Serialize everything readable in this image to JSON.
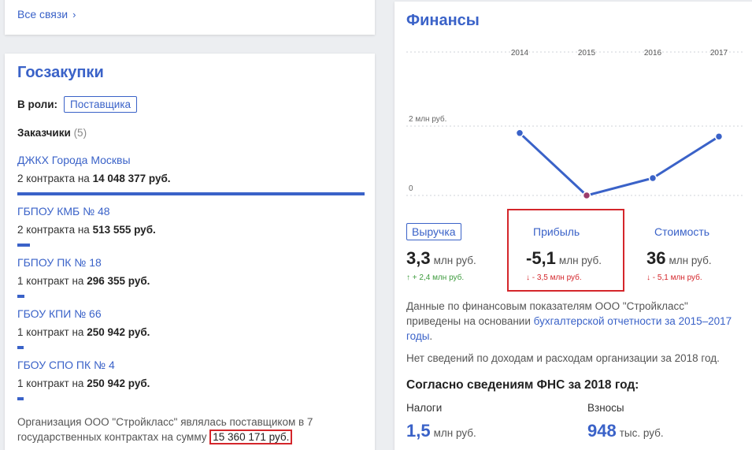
{
  "links_card": {
    "all_links": "Все связи",
    "chevron": "›"
  },
  "goszakupki": {
    "title": "Госзакупки",
    "role_label": "В роли:",
    "role_value": "Поставщика",
    "customers_label": "Заказчики",
    "customers_count": "(5)",
    "customers": [
      {
        "name": "ДЖКХ Города Москвы",
        "info_prefix": "2 контракта на",
        "amount": "14 048 377 руб.",
        "bar_fraction": 1.0
      },
      {
        "name": "ГБПОУ КМБ № 48",
        "info_prefix": "2 контракта на",
        "amount": "513 555 руб.",
        "bar_fraction": 0.037
      },
      {
        "name": "ГБПОУ ПК № 18",
        "info_prefix": "1 контракт на",
        "amount": "296 355 руб.",
        "bar_fraction": 0.021
      },
      {
        "name": "ГБОУ КПИ № 66",
        "info_prefix": "1 контракт на",
        "amount": "250 942 руб.",
        "bar_fraction": 0.018
      },
      {
        "name": "ГБОУ СПО ПК № 4",
        "info_prefix": "1 контракт на",
        "amount": "250 942 руб.",
        "bar_fraction": 0.018
      }
    ],
    "summary_text": "Организация ООО \"Стройкласс\" являлась поставщиком в 7 государственных контрактах на сумму",
    "summary_sum": "15 360 171 руб."
  },
  "finance": {
    "title": "Финансы",
    "kpis": [
      {
        "tab": "Выручка",
        "value": "3,3",
        "unit": "млн руб.",
        "arrow": "↑",
        "delta": "+ 2,4 млн руб.",
        "dir": "up"
      },
      {
        "tab": "Прибыль",
        "value": "-5,1",
        "unit": "млн руб.",
        "arrow": "↓",
        "delta": "- 3,5 млн руб.",
        "dir": "down"
      },
      {
        "tab": "Стоимость",
        "value": "36",
        "unit": "млн руб.",
        "arrow": "↓",
        "delta": "- 5,1 млн руб.",
        "dir": "down"
      }
    ],
    "note_prefix": "Данные по финансовым показателям ООО \"Стройкласс\" приведены на основании",
    "note_link": "бухгалтерской отчетности за 2015–2017 годы",
    "note_suffix": ".",
    "nodata": "Нет сведений по доходам и расходам организации за 2018 год.",
    "fns_head": "Согласно сведениям ФНС за 2018 год:",
    "taxes": {
      "label": "Налоги",
      "value": "1,5",
      "unit": "млн руб."
    },
    "fees": {
      "label": "Взносы",
      "value": "948",
      "unit": "тыс. руб."
    },
    "colors": {
      "accent": "#3a62c8",
      "highlight": "#d4262b",
      "up": "#3e9b3e"
    }
  },
  "chart_data": {
    "type": "line",
    "x": [
      "2014",
      "2015",
      "2016",
      "2017"
    ],
    "series": [
      {
        "values": [
          1.8,
          0.0,
          0.5,
          1.7
        ]
      }
    ],
    "y_tick_labels": [
      "0",
      "2 млн руб."
    ],
    "y_ticks": [
      0,
      2
    ],
    "ylim": [
      0,
      2
    ],
    "grid": true
  }
}
